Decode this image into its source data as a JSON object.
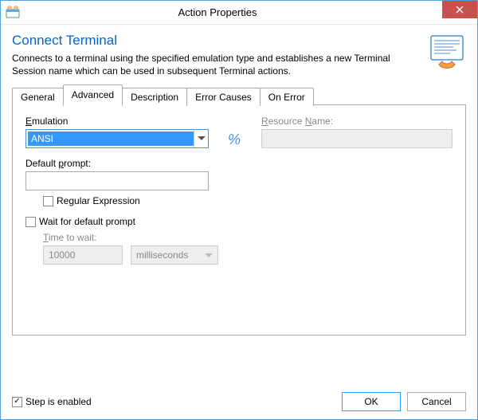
{
  "window": {
    "title": "Action Properties"
  },
  "header": {
    "title": "Connect Terminal",
    "description": "Connects to a terminal using the specified emulation type and establishes a new Terminal Session name which can be used in subsequent Terminal actions."
  },
  "tabs": {
    "general": "General",
    "advanced": "Advanced",
    "description": "Description",
    "error_causes": "Error Causes",
    "on_error": "On Error",
    "active": "advanced"
  },
  "panel": {
    "emulation_label": "Emulation",
    "emulation_value": "ANSI",
    "resource_name_label": "Resource Name:",
    "resource_name_value": "",
    "default_prompt_label": "Default prompt:",
    "default_prompt_value": "",
    "regex_label": "Regular Expression",
    "regex_checked": false,
    "wait_label": "Wait for default prompt",
    "wait_checked": false,
    "time_to_wait_label": "Time to wait:",
    "time_to_wait_value": "10000",
    "time_unit": "milliseconds"
  },
  "footer": {
    "step_enabled_label": "Step is enabled",
    "step_enabled_checked": true,
    "ok": "OK",
    "cancel": "Cancel"
  }
}
